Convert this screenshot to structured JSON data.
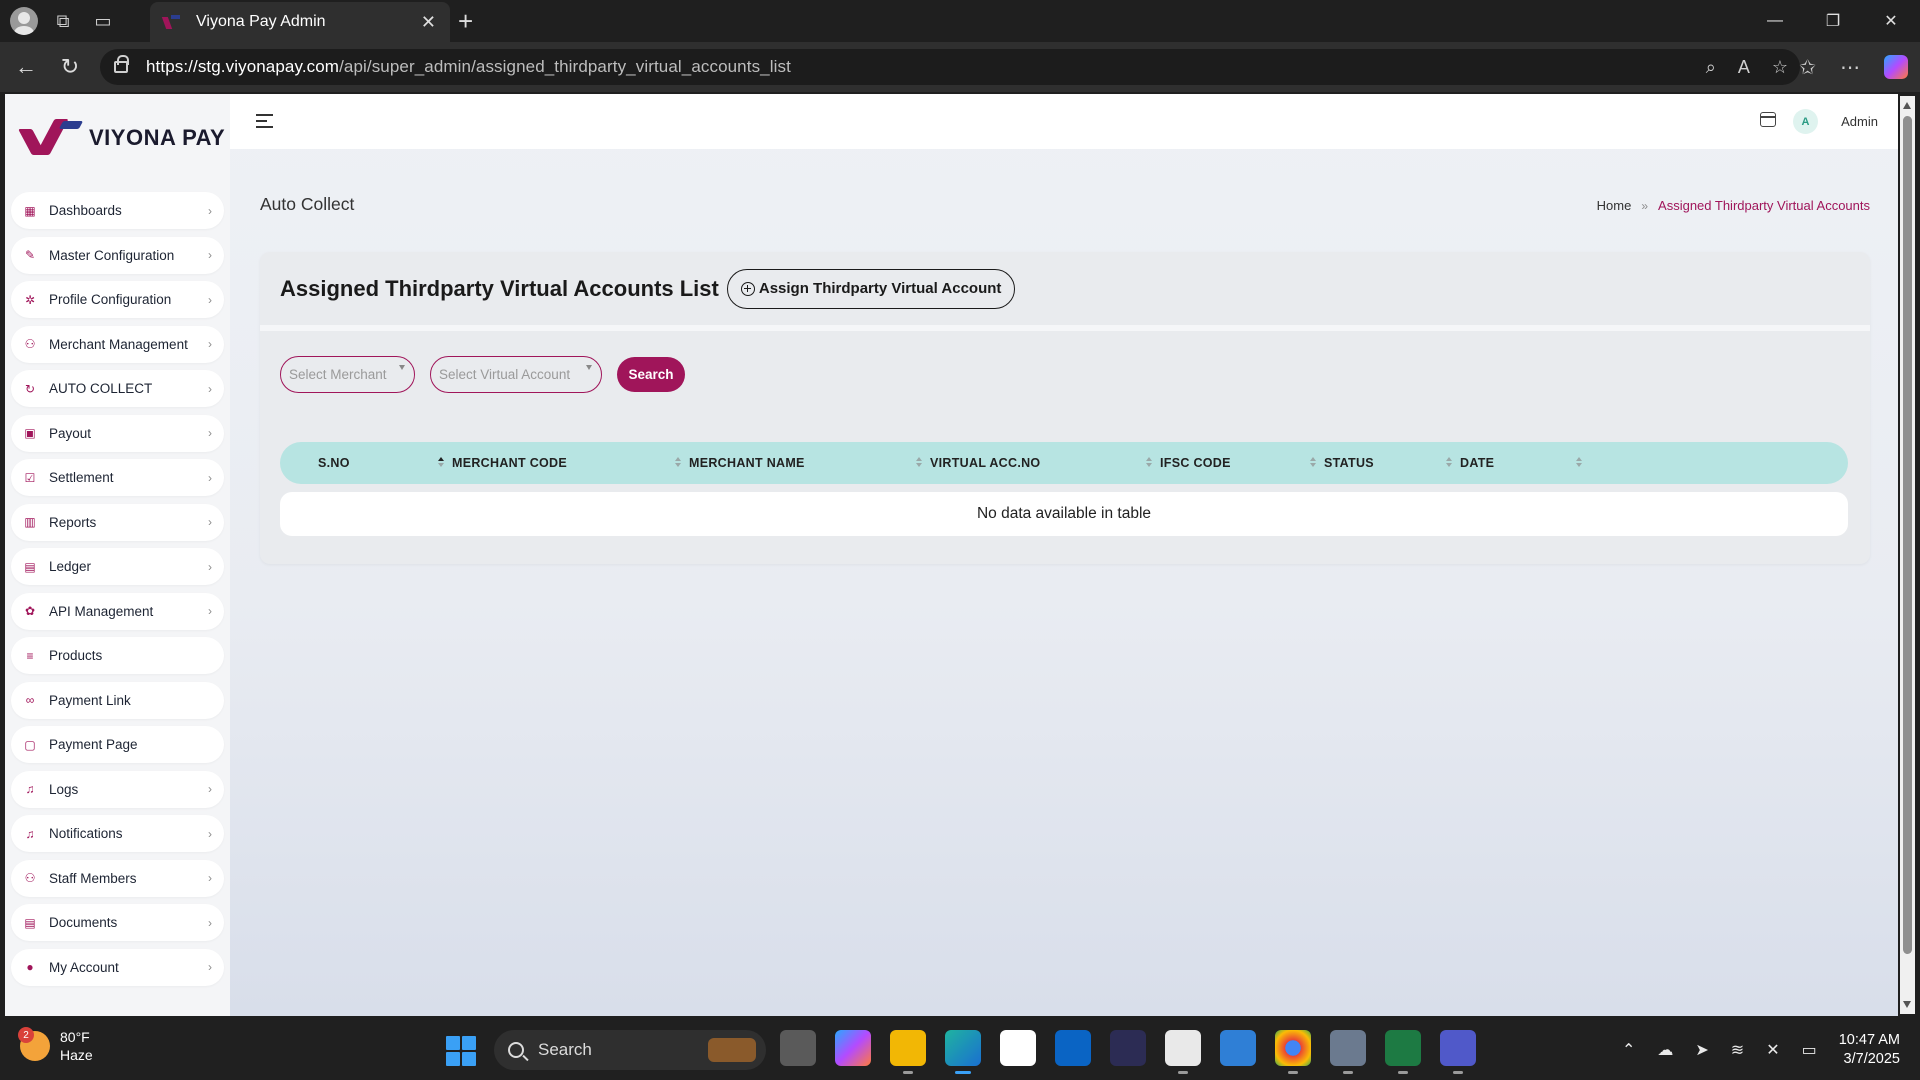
{
  "browser": {
    "tab_title": "Viyona Pay Admin",
    "url_host": "https://stg.viyonapay.com",
    "url_path": "/api/super_admin/assigned_thirdparty_virtual_accounts_list"
  },
  "sidebar": {
    "brand": "VIYONA PAY",
    "items": [
      {
        "label": "Dashboards",
        "icon": "grid-icon",
        "chevron": true
      },
      {
        "label": "Master Configuration",
        "icon": "wrench-icon",
        "chevron": true
      },
      {
        "label": "Profile Configuration",
        "icon": "gear-icon",
        "chevron": true
      },
      {
        "label": "Merchant Management",
        "icon": "users-icon",
        "chevron": true
      },
      {
        "label": "AUTO COLLECT",
        "icon": "refresh-icon",
        "chevron": true
      },
      {
        "label": "Payout",
        "icon": "wallet-icon",
        "chevron": true
      },
      {
        "label": "Settlement",
        "icon": "checkbox-icon",
        "chevron": true
      },
      {
        "label": "Reports",
        "icon": "chart-icon",
        "chevron": true
      },
      {
        "label": "Ledger",
        "icon": "ledger-icon",
        "chevron": true
      },
      {
        "label": "API Management",
        "icon": "cog-icon",
        "chevron": true
      },
      {
        "label": "Products",
        "icon": "list-icon",
        "chevron": false
      },
      {
        "label": "Payment Link",
        "icon": "link-icon",
        "chevron": false
      },
      {
        "label": "Payment Page",
        "icon": "page-icon",
        "chevron": false
      },
      {
        "label": "Logs",
        "icon": "bell-icon",
        "chevron": true
      },
      {
        "label": "Notifications",
        "icon": "bell-icon",
        "chevron": true
      },
      {
        "label": "Staff Members",
        "icon": "users-icon",
        "chevron": true
      },
      {
        "label": "Documents",
        "icon": "document-icon",
        "chevron": true
      },
      {
        "label": "My Account",
        "icon": "user-circle-icon",
        "chevron": true
      }
    ]
  },
  "topbar": {
    "avatar_initial": "A",
    "user_name": "Admin"
  },
  "page": {
    "title": "Auto Collect",
    "breadcrumb_home": "Home",
    "breadcrumb_current": "Assigned Thirdparty Virtual Accounts",
    "card_title": "Assigned Thirdparty Virtual Accounts List",
    "assign_button": "Assign Thirdparty Virtual Account",
    "merchant_placeholder": "Select Merchant",
    "virtual_account_placeholder": "Select Virtual Account",
    "search_button": "Search",
    "columns": [
      "S.NO",
      "MERCHANT CODE",
      "MERCHANT NAME",
      "VIRTUAL ACC.NO",
      "IFSC CODE",
      "STATUS",
      "DATE"
    ],
    "empty_message": "No data available in table"
  },
  "taskbar": {
    "weather_temp": "80°F",
    "weather_desc": "Haze",
    "weather_badge": "2",
    "search_label": "Search",
    "time": "10:47 AM",
    "date": "3/7/2025"
  },
  "colors": {
    "brand": "#a0155a",
    "brand_secondary": "#2b3d8f",
    "table_header": "#b7e4e2"
  }
}
